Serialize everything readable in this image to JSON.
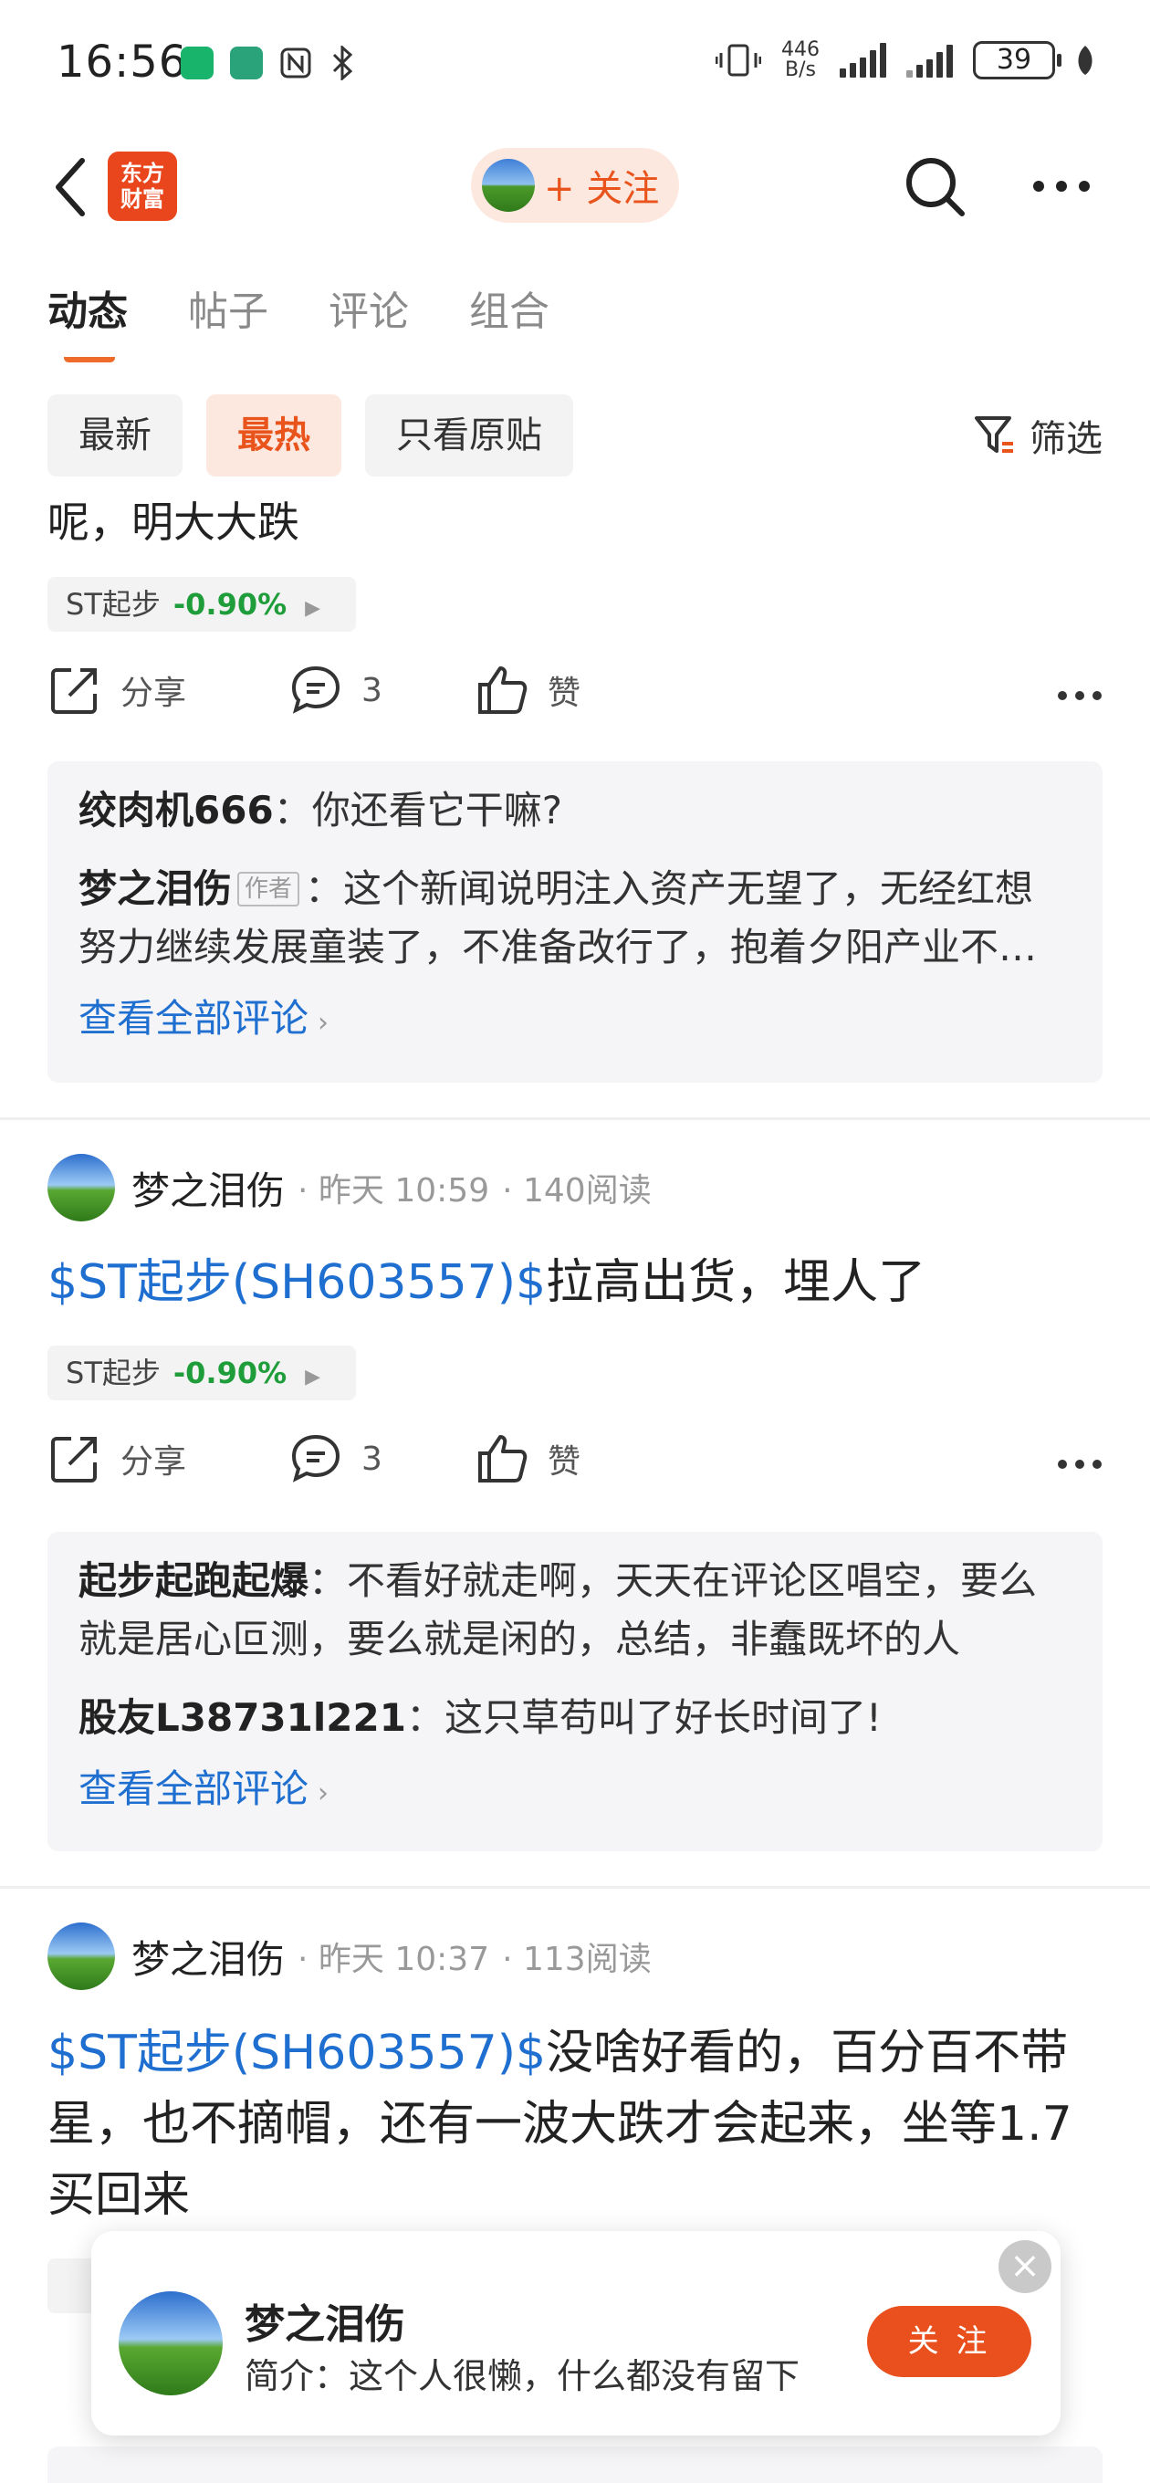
{
  "status_bar": {
    "time": "16:56",
    "net_speed_value": "446",
    "net_speed_unit": "B/s",
    "battery": "39"
  },
  "header": {
    "logo_text_line1": "东方",
    "logo_text_line2": "财富",
    "follow_label": "+ 关注"
  },
  "tabs": [
    {
      "label": "动态",
      "active": true
    },
    {
      "label": "帖子",
      "active": false
    },
    {
      "label": "评论",
      "active": false
    },
    {
      "label": "组合",
      "active": false
    }
  ],
  "filters": {
    "chips": [
      {
        "label": "最新",
        "active": false
      },
      {
        "label": "最热",
        "active": true
      },
      {
        "label": "只看原贴",
        "active": false
      }
    ],
    "filter_label": "筛选"
  },
  "post0": {
    "text_tail": "呢，明大大跌",
    "stock_tag": {
      "name": "ST起步",
      "change": "-0.90%"
    },
    "share_label": "分享",
    "comment_count": "3",
    "like_label": "赞",
    "comments": [
      {
        "user": "绞肉机666",
        "sep": "：",
        "text": "你还看它干嘛?"
      },
      {
        "user": "梦之泪伤",
        "badge": "作者",
        "sep": "：",
        "text": "这个新闻说明注入资产无望了，无经红想努力继续发展童装了，不准备改行了，抱着夕阳产业不放了"
      }
    ],
    "view_all": "查看全部评论"
  },
  "post1": {
    "user": "梦之泪伤",
    "time": "· 昨天 10:59",
    "reads": "· 140阅读",
    "stock_link": "$ST起步(SH603557)$",
    "text": "拉高出货，埋人了",
    "stock_tag": {
      "name": "ST起步",
      "change": "-0.90%"
    },
    "share_label": "分享",
    "comment_count": "3",
    "like_label": "赞",
    "comments": [
      {
        "user": "起步起跑起爆",
        "sep": "：",
        "text": "不看好就走啊，天天在评论区唱空，要么就是居心叵测，要么就是闲的，总结，非蠢既坏的人"
      },
      {
        "user": "股友L38731l221",
        "sep": "：",
        "text": "这只草苟叫了好长时间了!"
      }
    ],
    "view_all": "查看全部评论"
  },
  "post2": {
    "user": "梦之泪伤",
    "time": "· 昨天 10:37",
    "reads": "· 113阅读",
    "stock_link": "$ST起步(SH603557)$",
    "text": "没啥好看的，百分百不带星，也不摘帽，还有一波大跌才会起来，坐等1.7买回来"
  },
  "popup": {
    "name": "梦之泪伤",
    "bio": "简介：这个人很懒，什么都没有留下",
    "follow_label": "关 注",
    "close_glyph": "×"
  },
  "colors": {
    "accent": "#e9541d",
    "link": "#1f6fd1",
    "down_green": "#1f9d3a"
  }
}
